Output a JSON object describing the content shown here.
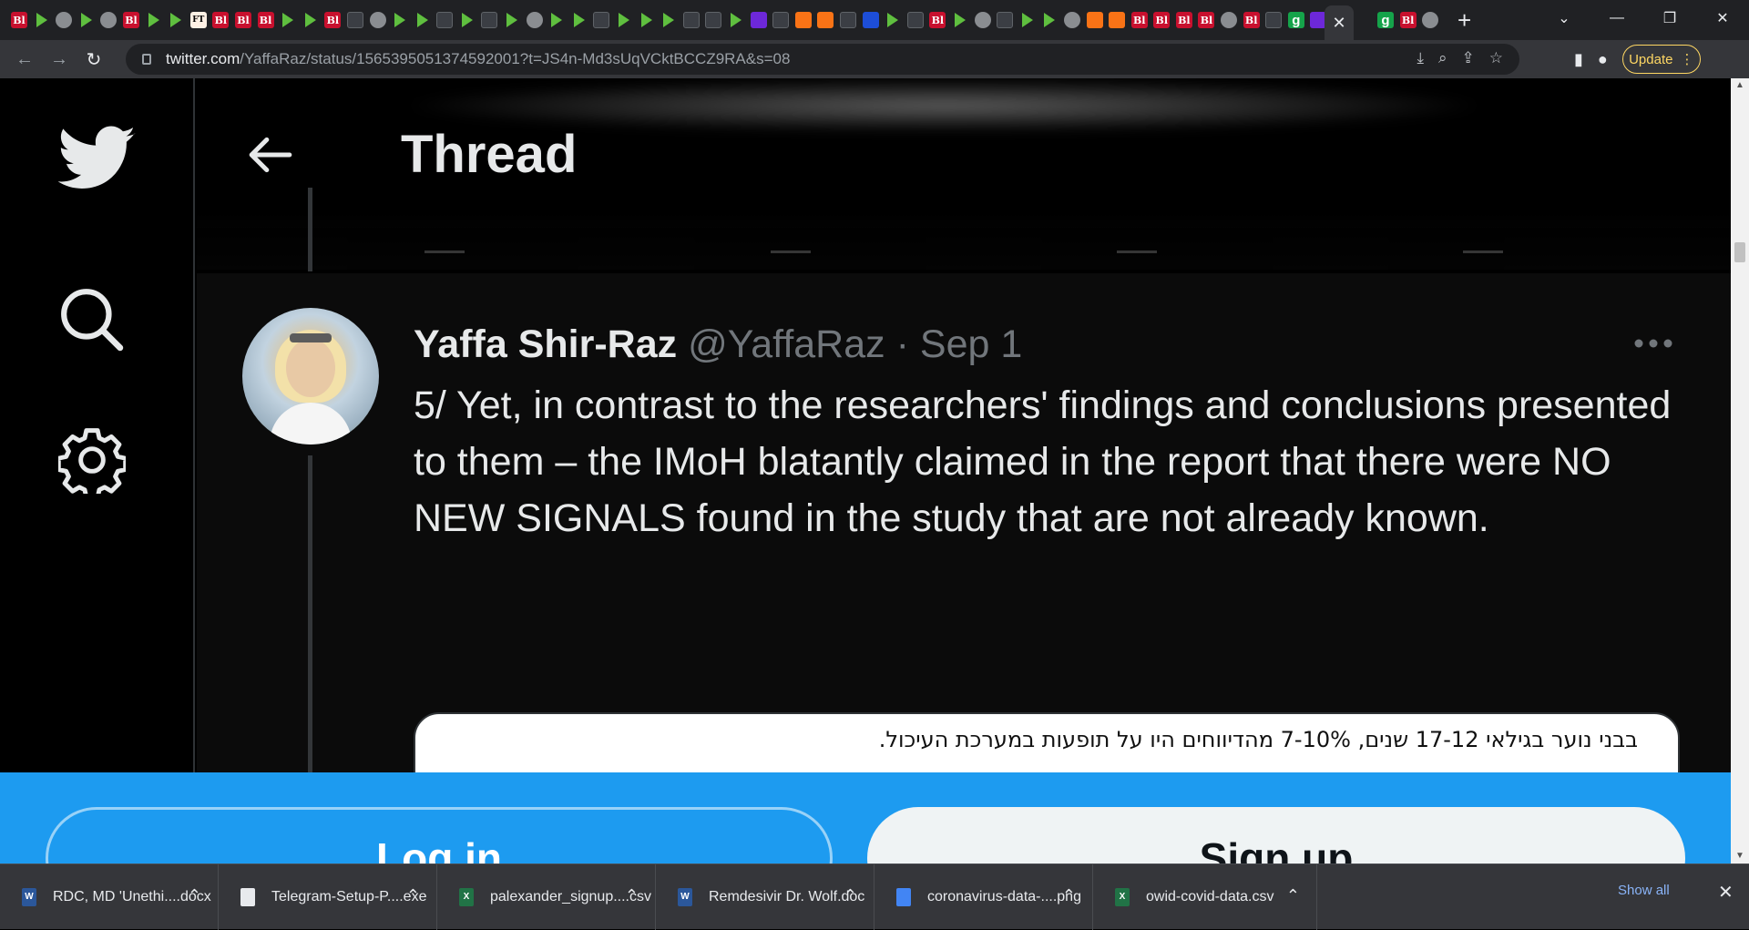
{
  "browser": {
    "active_tab_close": "✕",
    "new_tab": "+",
    "url_host": "twitter.com",
    "url_path": "/YaffaRaz/status/1565395051374592001?t=JS4n-Md3sUqVCktBCCZ9RA&s=08",
    "update_label": "Update",
    "tab_favicons": [
      "bi",
      "play",
      "globe",
      "play",
      "globe",
      "bi",
      "play",
      "play",
      "ft",
      "bi",
      "bi",
      "bi",
      "play",
      "play",
      "bi",
      "generic",
      "globe",
      "play",
      "play",
      "generic",
      "play",
      "generic",
      "play",
      "globe",
      "play",
      "play",
      "generic",
      "play",
      "play",
      "play",
      "generic",
      "generic",
      "play",
      "purple",
      "generic",
      "orange",
      "orange",
      "generic",
      "blue",
      "play",
      "generic",
      "bi",
      "play",
      "globe",
      "generic",
      "play",
      "play",
      "globe",
      "orange",
      "orange",
      "bi",
      "bi",
      "bi",
      "bi",
      "globe",
      "bi",
      "generic",
      "green",
      "purple",
      "generic"
    ],
    "tab_after_favicons": [
      "green",
      "bi",
      "globe"
    ]
  },
  "twitter": {
    "page_title": "Thread",
    "tweet": {
      "author_name": "Yaffa Shir-Raz",
      "handle": "@YaffaRaz",
      "separator": "·",
      "date": "Sep 1",
      "text": "5/ Yet, in contrast to the researchers' findings and conclusions presented to them –  the IMoH blatantly claimed in the report that there were NO NEW SIGNALS found in the study that are not already known.",
      "media_text": "בבני נוער בגילאי 17-12 שנים, 7-10% מהדיווחים היו על תופעות במערכת העיכול."
    },
    "login_label": "Log in",
    "signup_label": "Sign up"
  },
  "downloads": {
    "items": [
      {
        "name": "RDC, MD 'Unethi....docx",
        "type": "word",
        "width": 240
      },
      {
        "name": "Telegram-Setup-P....exe",
        "type": "exe",
        "width": 240
      },
      {
        "name": "palexander_signup....csv",
        "type": "excel",
        "width": 240
      },
      {
        "name": "Remdesivir Dr. Wolf.doc",
        "type": "word",
        "width": 240
      },
      {
        "name": "coronavirus-data-....png",
        "type": "png",
        "width": 240
      },
      {
        "name": "owid-covid-data.csv",
        "type": "excel",
        "width": 246
      }
    ],
    "show_all_label": "Show all"
  }
}
